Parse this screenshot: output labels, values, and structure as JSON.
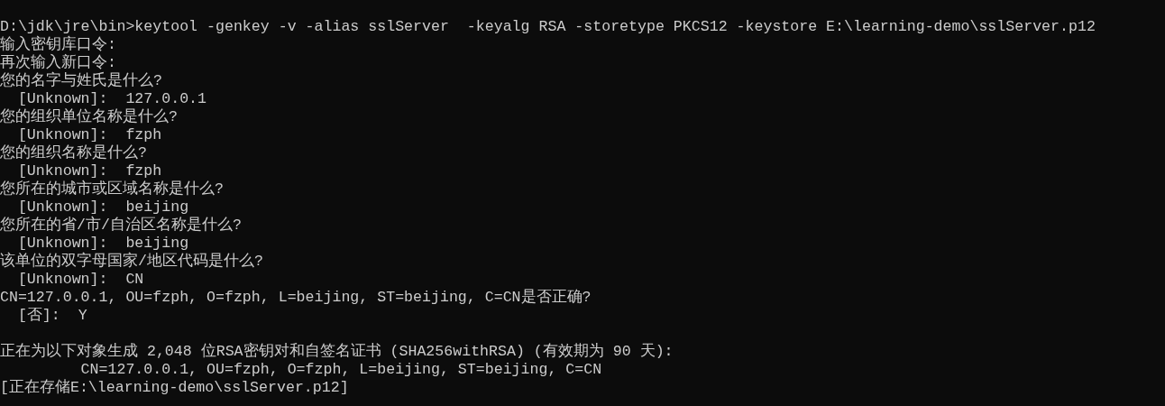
{
  "console": {
    "blocks": [
      [
        "D:\\jdk\\jre\\bin>keytool -genkey -v -alias sslServer  -keyalg RSA -storetype PKCS12 -keystore E:\\learning-demo\\sslServer.p12",
        "输入密钥库口令:",
        "再次输入新口令:",
        "您的名字与姓氏是什么?",
        "  [Unknown]:  127.0.0.1",
        "您的组织单位名称是什么?",
        "  [Unknown]:  fzph",
        "您的组织名称是什么?",
        "  [Unknown]:  fzph",
        "您所在的城市或区域名称是什么?",
        "  [Unknown]:  beijing",
        "您所在的省/市/自治区名称是什么?",
        "  [Unknown]:  beijing",
        "该单位的双字母国家/地区代码是什么?",
        "  [Unknown]:  CN",
        "CN=127.0.0.1, OU=fzph, O=fzph, L=beijing, ST=beijing, C=CN是否正确?",
        "  [否]:  Y"
      ],
      [
        "正在为以下对象生成 2,048 位RSA密钥对和自签名证书 (SHA256withRSA) (有效期为 90 天):",
        "         CN=127.0.0.1, OU=fzph, O=fzph, L=beijing, ST=beijing, C=CN",
        "[正在存储E:\\learning-demo\\sslServer.p12]"
      ]
    ]
  }
}
